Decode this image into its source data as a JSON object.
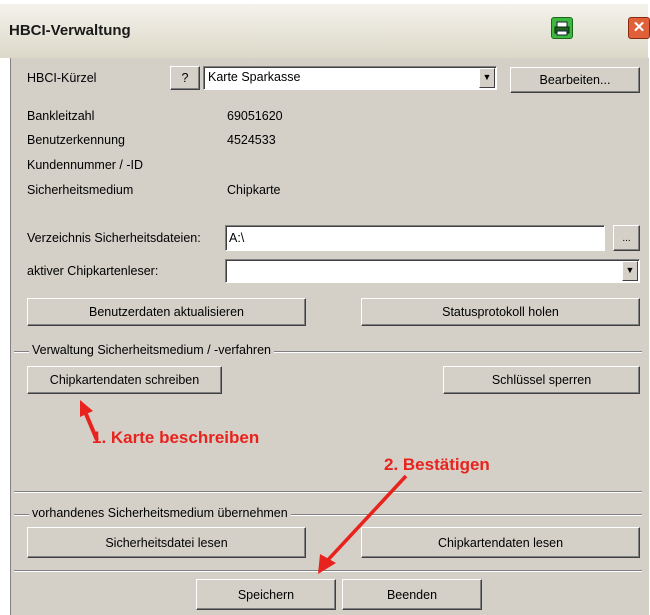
{
  "window": {
    "title": "HBCI-Verwaltung"
  },
  "form": {
    "kuerzel_label": "HBCI-Kürzel",
    "help_label": "?",
    "kuerzel_value": "Karte Sparkasse",
    "edit_button": "Bearbeiten...",
    "blz_label": "Bankleitzahl",
    "blz_value": "69051620",
    "user_label": "Benutzerkennung",
    "user_value": "4524533",
    "customer_label": "Kundennummer / -ID",
    "customer_value": "",
    "medium_label": "Sicherheitsmedium",
    "medium_value": "Chipkarte",
    "dir_label": "Verzeichnis Sicherheitsdateien:",
    "dir_value": "A:\\",
    "browse_label": "...",
    "reader_label": "aktiver Chipkartenleser:",
    "reader_value": ""
  },
  "buttons": {
    "update_userdata": "Benutzerdaten aktualisieren",
    "get_status": "Statusprotokoll holen",
    "write_card": "Chipkartendaten schreiben",
    "lock_key": "Schlüssel sperren",
    "read_file": "Sicherheitsdatei lesen",
    "read_card": "Chipkartendaten lesen",
    "save": "Speichern",
    "exit": "Beenden"
  },
  "groups": {
    "admin": "Verwaltung Sicherheitsmedium / -verfahren",
    "existing": "vorhandenes Sicherheitsmedium übernehmen"
  },
  "annotations": {
    "step1": "1. Karte beschreiben",
    "step2": "2. Bestätigen"
  },
  "colors": {
    "annotation": "#e8231e",
    "dialog_bg": "#d4d0c8"
  },
  "icons": {
    "print": "printer-icon",
    "close": "close-icon"
  }
}
